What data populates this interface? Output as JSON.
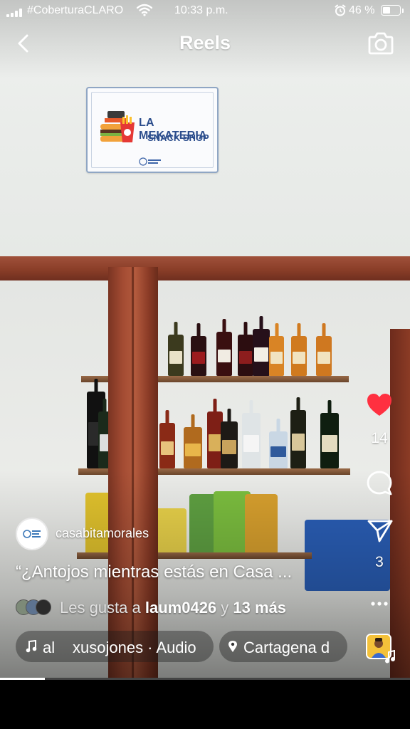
{
  "status_bar": {
    "carrier": "#CoberturaCLARO",
    "time": "10:33 p.m.",
    "battery_percent": "46 %",
    "battery_level": 0.46,
    "icons": [
      "signal-icon",
      "wifi-icon",
      "alarm-icon",
      "battery-icon"
    ]
  },
  "header": {
    "title": "Reels",
    "icons": [
      "back-chevron-icon",
      "camera-icon"
    ]
  },
  "video": {
    "sign_title": "LA MEKATERIA",
    "sign_subtitle": "SNACK SHOP"
  },
  "actions": {
    "like_count": "14",
    "share_count": "3",
    "liked": true,
    "like_color": "#ff3040",
    "icons": [
      "heart-icon",
      "comment-icon",
      "share-icon",
      "more-icon"
    ]
  },
  "post": {
    "username": "casabitamorales",
    "caption": "“¿Antojos mientras estás en Casa ...",
    "likes_prefix": "Les gusta a",
    "likes_user": "laum0426",
    "likes_connector": "y",
    "likes_others": "13 más"
  },
  "audio": {
    "visible_text_start": "al",
    "visible_text": "xusojones · Audio",
    "location": "Cartagena d",
    "icons": [
      "music-note-icon",
      "location-pin-icon"
    ]
  },
  "playback": {
    "progress": 0.11
  }
}
